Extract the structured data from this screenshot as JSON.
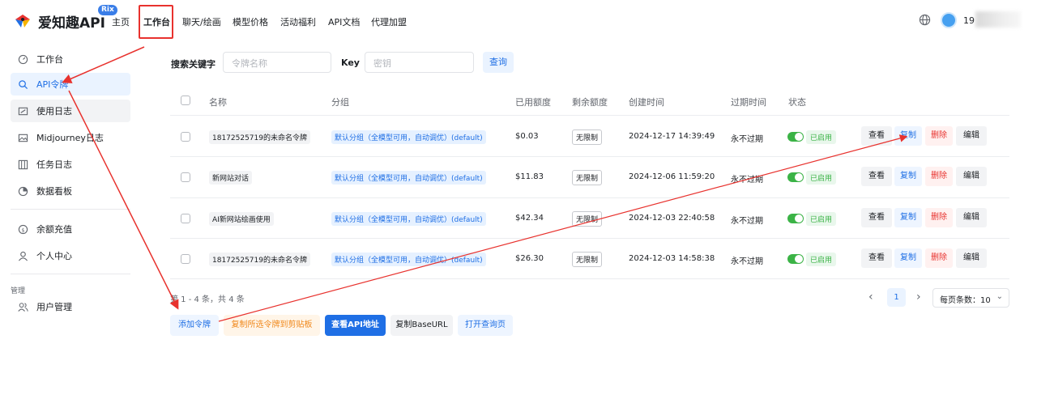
{
  "header": {
    "brand": "爱知趣API",
    "badge": "Rix",
    "nav": [
      "主页",
      "工作台",
      "聊天/绘画",
      "模型价格",
      "活动福利",
      "API文档",
      "代理加盟"
    ],
    "user_name_prefix": "19"
  },
  "sidebar": {
    "items": [
      {
        "label": "工作台",
        "icon": "dashboard-icon"
      },
      {
        "label": "API令牌",
        "icon": "key-icon"
      },
      {
        "label": "使用日志",
        "icon": "log-icon"
      },
      {
        "label": "Midjourney日志",
        "icon": "image-icon"
      },
      {
        "label": "任务日志",
        "icon": "task-icon"
      },
      {
        "label": "数据看板",
        "icon": "chart-icon"
      },
      {
        "label": "余额充值",
        "icon": "coin-icon"
      },
      {
        "label": "个人中心",
        "icon": "user-icon"
      }
    ],
    "group_label": "管理",
    "admin_items": [
      {
        "label": "用户管理",
        "icon": "users-icon"
      }
    ]
  },
  "search": {
    "keyword_label": "搜索关键字",
    "keyword_placeholder": "令牌名称",
    "key_label": "Key",
    "key_placeholder": "密钥",
    "query_button": "查询"
  },
  "table": {
    "headers": [
      "名称",
      "分组",
      "已用额度",
      "剩余额度",
      "创建时间",
      "过期时间",
      "状态"
    ],
    "rows": [
      {
        "name": "18172525719的未命名令牌",
        "group": "默认分组（全模型可用，自动调优）(default)",
        "used": "$0.03",
        "remaining": "无限制",
        "created": "2024-12-17 14:39:49",
        "expires": "永不过期",
        "status": "已启用"
      },
      {
        "name": "新网站对话",
        "group": "默认分组（全模型可用，自动调优）(default)",
        "used": "$11.83",
        "remaining": "无限制",
        "created": "2024-12-06 11:59:20",
        "expires": "永不过期",
        "status": "已启用"
      },
      {
        "name": "AI新网站绘画使用",
        "group": "默认分组（全模型可用，自动调优）(default)",
        "used": "$42.34",
        "remaining": "无限制",
        "created": "2024-12-03 22:40:58",
        "expires": "永不过期",
        "status": "已启用"
      },
      {
        "name": "18172525719的未命名令牌",
        "group": "默认分组（全模型可用，自动调优）(default)",
        "used": "$26.30",
        "remaining": "无限制",
        "created": "2024-12-03 14:58:38",
        "expires": "永不过期",
        "status": "已启用"
      }
    ],
    "actions": {
      "view": "查看",
      "copy": "复制",
      "delete": "删除",
      "edit": "编辑"
    }
  },
  "pagination": {
    "info": "第 1 - 4 条，共 4 条",
    "current_page": "1",
    "page_size_label": "每页条数：10"
  },
  "bottom_buttons": {
    "add": "添加令牌",
    "copy_selected": "复制所选令牌到剪贴板",
    "view_api": "查看API地址",
    "copy_base": "复制BaseURL",
    "open_query": "打开查询页"
  },
  "colors": {
    "accent": "#1f6fe5",
    "danger": "#e8322e",
    "success": "#3bb346",
    "warning": "#f0891d",
    "annotation": "#e8322e"
  }
}
